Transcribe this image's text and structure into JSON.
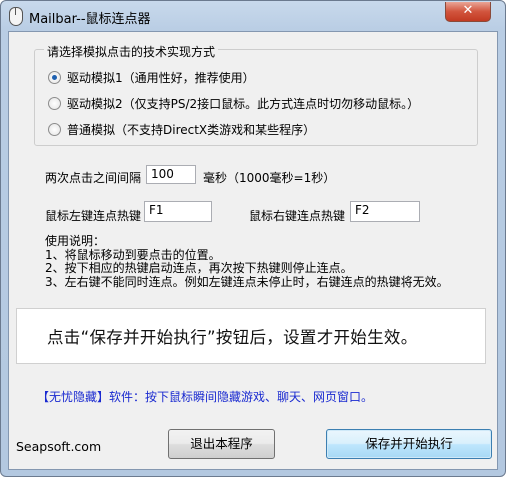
{
  "window": {
    "title": "Mailbar--鼠标连点器",
    "close_label": "✕"
  },
  "method_group": {
    "title": "请选择模拟点击的技术实现方式",
    "options": [
      {
        "label": "驱动模拟1（通用性好，推荐使用）",
        "checked": true
      },
      {
        "label": "驱动模拟2（仅支持PS/2接口鼠标。此方式连点时切勿移动鼠标。）",
        "checked": false
      },
      {
        "label": "普通模拟（不支持DirectX类游戏和某些程序）",
        "checked": false
      }
    ]
  },
  "interval": {
    "label": "两次点击之间间隔",
    "value": "100",
    "unit": "毫秒（1000毫秒=1秒）"
  },
  "hotkeys": {
    "left_label": "鼠标左键连点热键",
    "left_value": "F1",
    "right_label": "鼠标右键连点热键",
    "right_value": "F2"
  },
  "instructions": {
    "title": "使用说明：",
    "lines": [
      "1、将鼠标移动到要点击的位置。",
      "2、按下相应的热键启动连点，再次按下热键则停止连点。",
      "3、左右键不能同时连点。例如左键连点未停止时，右键连点的热键将无效。"
    ]
  },
  "notice": "点击“保存并开始执行”按钮后，设置才开始生效。",
  "promo": "【无忧隐藏】软件：按下鼠标瞬间隐藏游戏、聊天、网页窗口。",
  "footer": {
    "brand": "Seapsoft.com",
    "exit_label": "退出本程序",
    "save_label": "保存并开始执行"
  }
}
